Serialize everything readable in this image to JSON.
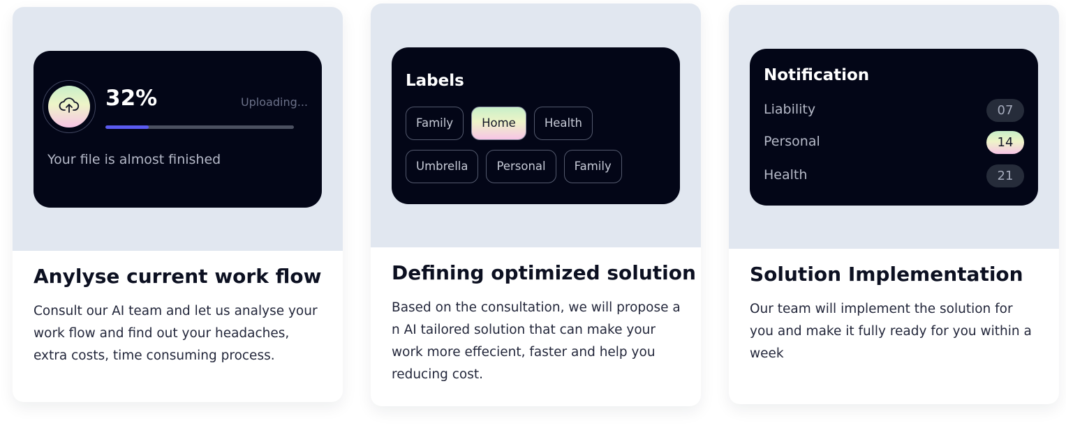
{
  "cards": [
    {
      "title": "Anylyse current work flow",
      "text": "Consult our AI team and let us analyse your work flow and find out your headaches, extra costs, time consuming process.",
      "upload": {
        "percent_label": "32%",
        "progress": 0.23,
        "status": "Uploading...",
        "message": "Your file is almost finished",
        "icon": "cloud-upload-icon"
      }
    },
    {
      "title": "Defining optimized solution",
      "text": "Based on the consultation, we will propose a n AI tailored solution that can make your work more effecient, faster and help you reducing cost.",
      "labels": {
        "heading": "Labels",
        "chips": [
          "Family",
          "Home",
          "Health",
          "Umbrella",
          "Personal",
          "Family"
        ],
        "active_index": 1
      }
    },
    {
      "title": "Solution Implementation",
      "text": "Our team will implement the solution for you and make it fully ready for you within a week",
      "notifications": {
        "heading": "Notification",
        "items": [
          {
            "label": "Liability",
            "count": "07"
          },
          {
            "label": "Personal",
            "count": "14",
            "active": true
          },
          {
            "label": "Health",
            "count": "21"
          }
        ]
      }
    }
  ],
  "colors": {
    "hero_bg": "#e1e7f0",
    "panel_bg": "#030617",
    "progress_fill": "#5b5bf1"
  }
}
